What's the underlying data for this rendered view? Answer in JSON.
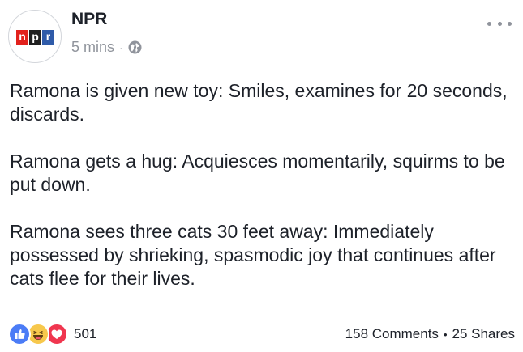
{
  "post": {
    "page_name": "NPR",
    "timestamp": "5 mins",
    "meta_separator": "·",
    "logo": {
      "letters": [
        "n",
        "p",
        "r"
      ],
      "colors": [
        "#e2211c",
        "#1f1f1f",
        "#2f5ba9"
      ]
    },
    "privacy_icon": "globe-icon",
    "paragraphs": [
      "Ramona is given new toy: Smiles, examines for 20 seconds, discards.",
      "Ramona gets a hug: Acquiesces momentarily, squirms to be put down.",
      "Ramona sees three cats 30 feet away: Immediately possessed by shrieking, spasmodic joy that continues after cats flee for their lives."
    ]
  },
  "footer": {
    "reaction_icons": [
      "like-icon",
      "haha-icon",
      "love-icon"
    ],
    "reaction_colors": {
      "like": "#4b7cf6",
      "haha": "#f7c84c",
      "love": "#f0364f"
    },
    "reaction_count": "501",
    "comments": "158 Comments",
    "separator": "•",
    "shares": "25 Shares"
  }
}
